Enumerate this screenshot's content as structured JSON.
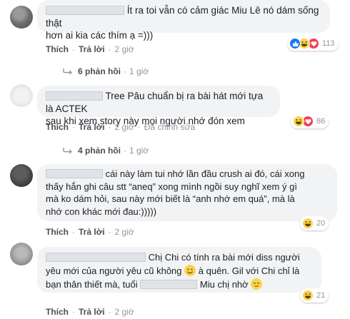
{
  "comments": [
    {
      "text_before": "",
      "text_lines": [
        "Ít ra toi vẫn có cảm giác Miu Lê nó dám sống thật",
        "hơn ai kia các thím ạ =)))"
      ],
      "actions": {
        "like": "Thích",
        "reply": "Trả lời",
        "time": "2 giờ",
        "edited": ""
      },
      "reactions": {
        "types": [
          "like-icon",
          "laugh-icon",
          "heart-icon"
        ],
        "count": "113"
      },
      "replies": {
        "count": "6 phản hồi",
        "time": "1 giờ"
      }
    },
    {
      "text_lines": [
        "Tree Pâu chuẩn bị ra bài hát mới tựa là ACTEK",
        "sau khi xem story này mọi người nhớ đón xem"
      ],
      "actions": {
        "like": "Thích",
        "reply": "Trả lời",
        "time": "2 giờ",
        "edited": "Đã chỉnh sửa"
      },
      "reactions": {
        "types": [
          "laugh-icon",
          "heart-icon"
        ],
        "count": "86"
      },
      "replies": {
        "count": "4 phản hồi",
        "time": "1 giờ"
      }
    },
    {
      "text_lines": [
        "cái này làm tui nhớ lần đầu crush ai đó, cái xong",
        "thấy hắn ghi câu stt “aneq” xong mình ngồi suy nghĩ xem ý gì",
        "mà ko dám hỏi, sau này mới biết là “anh nhớ em quá”, mà là",
        "nhớ con khác mới đau:)))))"
      ],
      "actions": {
        "like": "Thích",
        "reply": "Trả lời",
        "time": "2 giờ",
        "edited": ""
      },
      "reactions": {
        "types": [
          "laugh-icon"
        ],
        "count": "20"
      }
    },
    {
      "text_lines": [
        "Chị Chi có tính ra bài mới diss người",
        "yêu mới của người yêu cũ không",
        "à quên. Gil với Chi chỉ là",
        "bạn thân thiết mà, tuổi",
        "Miu chị nhờ"
      ],
      "actions": {
        "like": "Thích",
        "reply": "Trả lời",
        "time": "2 giờ",
        "edited": ""
      },
      "reactions": {
        "types": [
          "laugh-icon"
        ],
        "count": "21"
      }
    }
  ],
  "colors": {
    "bubble": "#f2f3f5",
    "link": "#4b4f56",
    "muted": "#90949c",
    "like": "#1877f2",
    "laugh": "#fcd34d"
  }
}
